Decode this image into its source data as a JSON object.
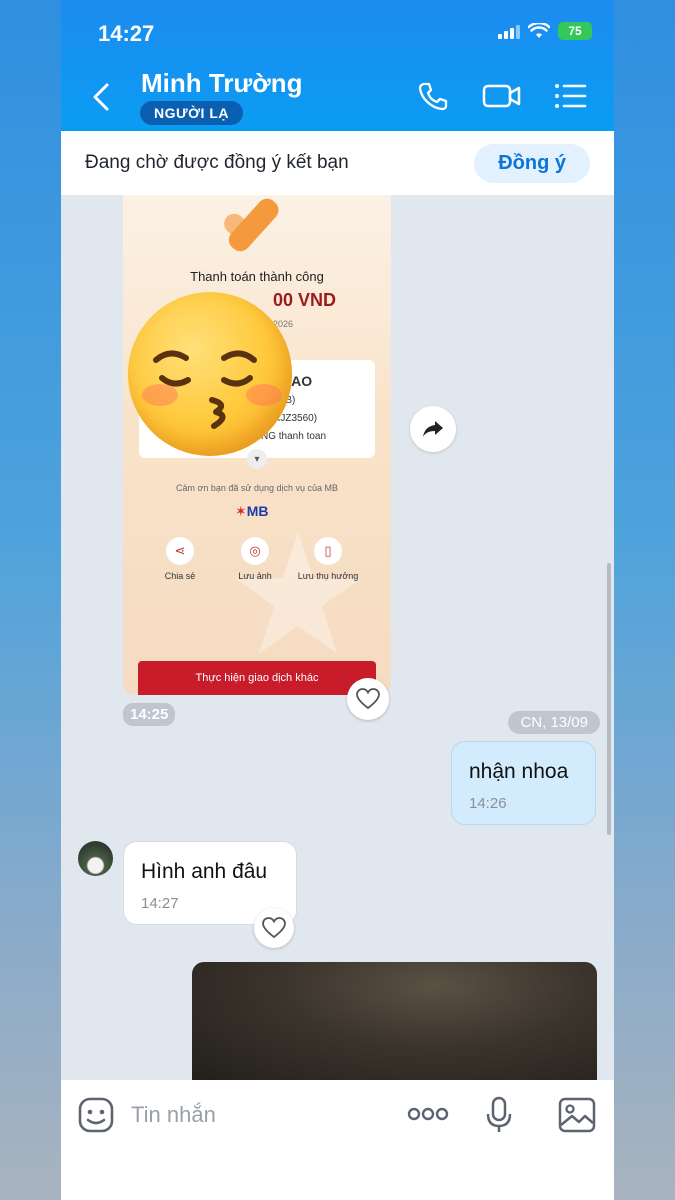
{
  "status_bar": {
    "time": "14:27",
    "battery": "75"
  },
  "header": {
    "contact_name": "Minh Trường",
    "badge": "NGƯỜI LẠ",
    "icons": [
      "back-icon",
      "phone-icon",
      "video-call-icon",
      "menu-list-icon"
    ]
  },
  "pending_bar": {
    "text": "Đang chờ được đồng ý kết bạn",
    "accept_label": "Đồng ý"
  },
  "receipt_image": {
    "title": "Thanh toán thành công",
    "amount": "00 VND",
    "date": "2026",
    "recipient": "HAO",
    "bank": "MB)",
    "account": "KXJZ3560)",
    "note": "NG thanh toan",
    "thanks": "Cảm ơn bạn đã sử dụng dịch vụ của MB",
    "brand": "MB",
    "actions": [
      "Chia sẻ",
      "Lưu ảnh",
      "Lưu thụ hưởng"
    ],
    "button": "Thực hiện giao dịch khác",
    "overlay": "kissing-face-with-closed-eyes-emoji",
    "time": "14:25"
  },
  "date_separator": "CN, 13/09",
  "messages": [
    {
      "direction": "out",
      "text": "nhận nhoa",
      "time": "14:26"
    },
    {
      "direction": "in",
      "text": "Hình anh đâu",
      "time": "14:27"
    }
  ],
  "input": {
    "placeholder": "Tin nhắn"
  },
  "colors": {
    "header": "#0a9cf3",
    "accent": "#0b76d9",
    "outgoing_bubble": "#d3ecfd"
  }
}
